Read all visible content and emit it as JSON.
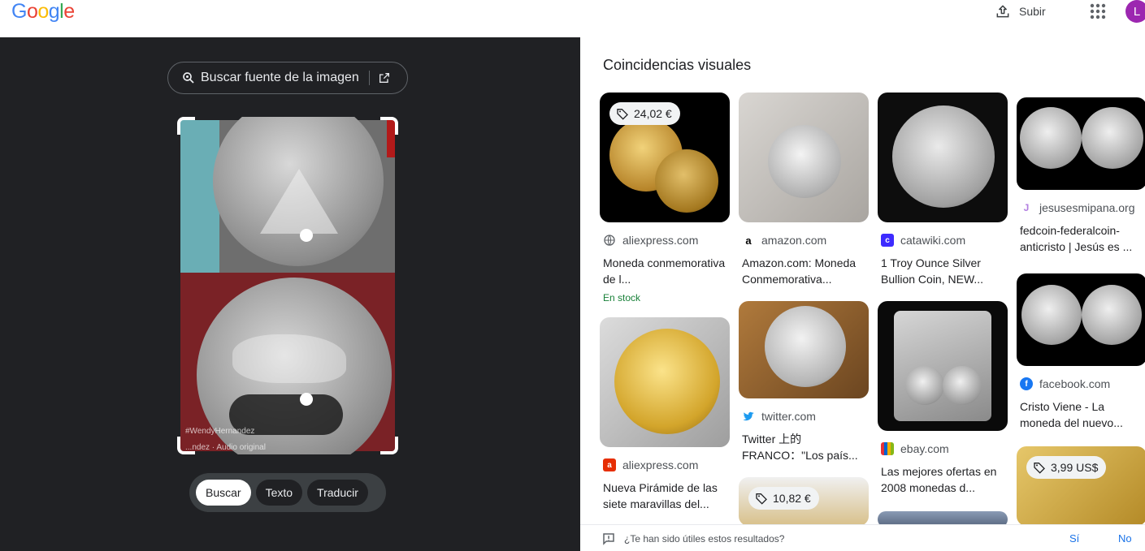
{
  "header": {
    "logo_letters": [
      {
        "ch": "G",
        "color": "#4285f4"
      },
      {
        "ch": "o",
        "color": "#ea4335"
      },
      {
        "ch": "o",
        "color": "#fbbc05"
      },
      {
        "ch": "g",
        "color": "#4285f4"
      },
      {
        "ch": "l",
        "color": "#34a853"
      },
      {
        "ch": "e",
        "color": "#ea4335"
      }
    ],
    "upload_label": "Subir",
    "upload_icon": "upload-icon",
    "apps_icon": "apps-grid-icon",
    "avatar_letter": "L"
  },
  "lens": {
    "search_source_label": "Buscar fuente de la imagen",
    "watermark_handle": "#WendyHernandez",
    "watermark_audio": "...ndez · Audio original",
    "modes": [
      "Buscar",
      "Texto",
      "Traducir"
    ],
    "active_mode": "Buscar"
  },
  "results": {
    "title": "Coincidencias visuales",
    "cards": [
      {
        "price": "24,02 €",
        "source": "aliexpress.com",
        "favicon": "globe",
        "title": "Moneda conmemorativa de l...",
        "stock": "En stock"
      },
      {
        "price": "",
        "source": "amazon.com",
        "favicon": "amazon",
        "title": "Amazon.com: Moneda Conmemorativa...",
        "stock": ""
      },
      {
        "price": "",
        "source": "catawiki.com",
        "favicon": "catawiki",
        "title": "1 Troy Ounce Silver Bullion Coin, NEW...",
        "stock": ""
      },
      {
        "price": "",
        "source": "jesusesmipana.org",
        "favicon": "jesus",
        "title": "fedcoin-federalcoin-anticristo | Jesús es ...",
        "stock": ""
      },
      {
        "price": "",
        "source": "aliexpress.com",
        "favicon": "aliexpress",
        "title": "Nueva Pirámide de las siete maravillas del...",
        "stock": ""
      },
      {
        "price": "",
        "source": "twitter.com",
        "favicon": "twitter",
        "title": "Twitter 上的 FRANCO：\"Los país...",
        "stock": ""
      },
      {
        "price": "",
        "source": "ebay.com",
        "favicon": "ebay",
        "title": "Las mejores ofertas en 2008 monedas d...",
        "stock": ""
      },
      {
        "price": "",
        "source": "facebook.com",
        "favicon": "facebook",
        "title": "Cristo Viene - La moneda del nuevo...",
        "stock": ""
      },
      {
        "price": "10,82 €",
        "source": "",
        "favicon": "",
        "title": "",
        "stock": ""
      },
      {
        "price": "3,99 US$",
        "source": "",
        "favicon": "",
        "title": "",
        "stock": ""
      }
    ]
  },
  "feedback": {
    "question": "¿Te han sido útiles estos resultados?",
    "yes": "Sí",
    "no": "No"
  },
  "colors": {
    "left_bg": "#202124",
    "accent": "#1a73e8",
    "stock": "#188038",
    "avatar": "#9c27b0"
  }
}
